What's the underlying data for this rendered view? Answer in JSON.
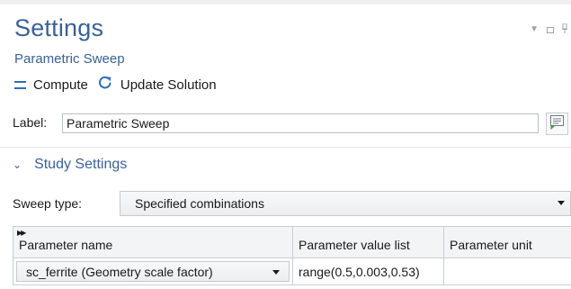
{
  "header": {
    "title": "Settings",
    "subtitle": "Parametric Sweep"
  },
  "toolbar": {
    "compute_label": "Compute",
    "update_label": "Update Solution"
  },
  "label_field": {
    "caption": "Label:",
    "value": "Parametric Sweep"
  },
  "section": {
    "title": "Study Settings"
  },
  "sweep": {
    "caption": "Sweep type:",
    "value": "Specified combinations"
  },
  "table": {
    "headers": [
      "Parameter name",
      "Parameter value list",
      "Parameter unit"
    ],
    "rows": [
      {
        "name": "sc_ferrite (Geometry scale factor)",
        "values": "range(0.5,0.003,0.53)",
        "unit": ""
      }
    ]
  },
  "colors": {
    "accent": "#3a6196",
    "icon_blue": "#2f6db5"
  }
}
